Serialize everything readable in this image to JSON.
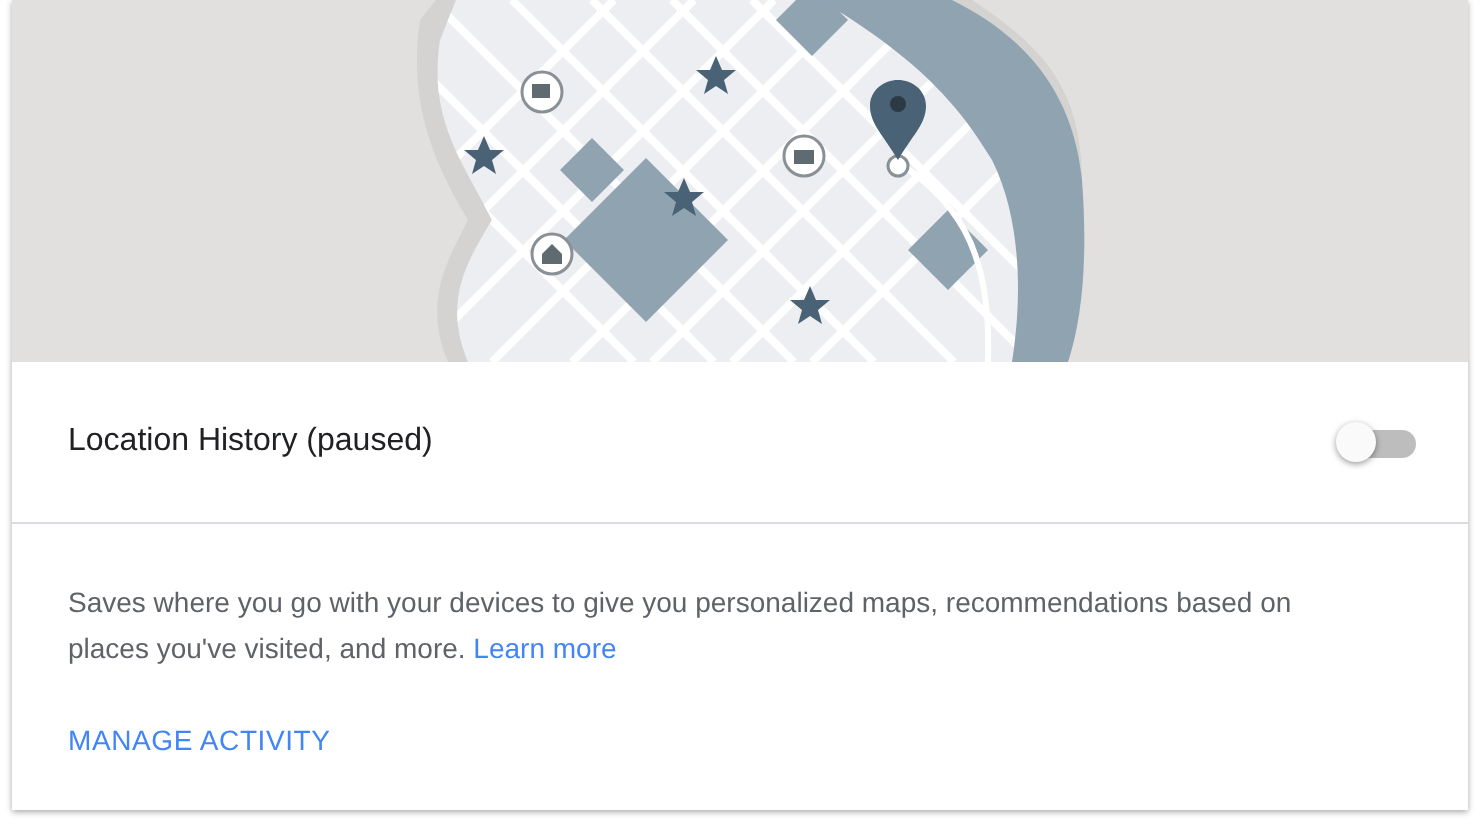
{
  "setting": {
    "title": "Location History (paused)",
    "on": false
  },
  "description": {
    "text": "Saves where you go with your devices to give you personalized maps, recommendations based on places you've visited, and more.",
    "link": "Learn more"
  },
  "action": "MANAGE ACTIVITY"
}
